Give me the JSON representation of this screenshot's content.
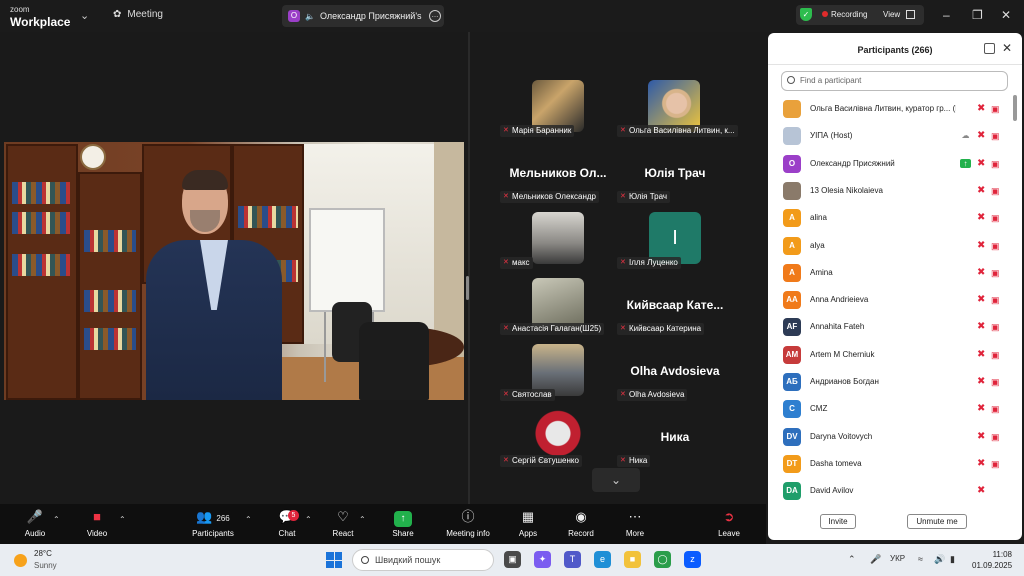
{
  "app": {
    "brand_top": "zoom",
    "brand_bottom": "Workplace",
    "meeting_label": "Meeting",
    "share_tab_avatar": "O",
    "share_tab_title": "Олександр Присяжний's screen",
    "recording_label": "Recording",
    "view_label": "View",
    "accent": "#0b5cff",
    "recording_color": "#e02b2b",
    "shield_color": "#2dbd4e"
  },
  "gallery": {
    "tiles": [
      {
        "name": "Марія Баранник",
        "big": ""
      },
      {
        "name": "Ольга Василівна Литвин, к...",
        "big": ""
      },
      {
        "name": "Мельников Олександр",
        "big": "Мельников Ол..."
      },
      {
        "name": "Юлія Трач",
        "big": "Юлія Трач"
      },
      {
        "name": "макс",
        "big": ""
      },
      {
        "name": "Ілля Луценко",
        "big": ""
      },
      {
        "name": "Анастасія Галаган(Ш25)",
        "big": ""
      },
      {
        "name": "Кийвсаар Катерина",
        "big": "Кийвсаар Кате..."
      },
      {
        "name": "Святослав",
        "big": ""
      },
      {
        "name": "Olha Avdosieva",
        "big": "Olha Avdosieva"
      },
      {
        "name": "Сергій Євтушенко",
        "big": ""
      },
      {
        "name": "Ника",
        "big": "Ника"
      }
    ],
    "illia_initial": "I"
  },
  "participants": {
    "title": "Participants (266)",
    "search_placeholder": "Find a participant",
    "list": [
      {
        "initials": "",
        "name": "Ольга Василівна Литвин, куратор гр... (Me)",
        "color": "#e9a13b",
        "extra": ""
      },
      {
        "initials": "",
        "name": "УІПА (Host)",
        "color": "#b7c4d6",
        "extra": "cloud"
      },
      {
        "initials": "О",
        "name": "Олександр Присяжний",
        "color": "#9b3fc8",
        "extra": "share"
      },
      {
        "initials": "",
        "name": "13 Olesia Nikolaieva",
        "color": "#8a7a6a",
        "extra": ""
      },
      {
        "initials": "A",
        "name": "alina",
        "color": "#f29b1a",
        "extra": ""
      },
      {
        "initials": "A",
        "name": "alya",
        "color": "#f29b1a",
        "extra": ""
      },
      {
        "initials": "A",
        "name": "Amina",
        "color": "#f07a1a",
        "extra": ""
      },
      {
        "initials": "AA",
        "name": "Anna Andrieieva",
        "color": "#f07a1a",
        "extra": ""
      },
      {
        "initials": "AF",
        "name": "Annahita Fateh",
        "color": "#2d3b55",
        "extra": ""
      },
      {
        "initials": "AM",
        "name": "Artem M Cherniuk",
        "color": "#c63b3b",
        "extra": ""
      },
      {
        "initials": "АБ",
        "name": "Андрианов Богдан",
        "color": "#2e6fbd",
        "extra": ""
      },
      {
        "initials": "C",
        "name": "CMZ",
        "color": "#2e7fd0",
        "extra": ""
      },
      {
        "initials": "DV",
        "name": "Daryna Voitovych",
        "color": "#2e6fbd",
        "extra": ""
      },
      {
        "initials": "DT",
        "name": "Dasha tomeva",
        "color": "#f29b1a",
        "extra": ""
      },
      {
        "initials": "DA",
        "name": "David Avilov",
        "color": "#1f9e6a",
        "extra": ""
      }
    ],
    "invite_label": "Invite",
    "unmute_label": "Unmute me"
  },
  "toolbar": {
    "audio": "Audio",
    "video": "Video",
    "participants": "Participants",
    "participants_count": "266",
    "chat": "Chat",
    "chat_badge": "5",
    "react": "React",
    "share": "Share",
    "meeting_info": "Meeting info",
    "apps": "Apps",
    "record": "Record",
    "more": "More",
    "leave": "Leave"
  },
  "taskbar": {
    "temp": "28°C",
    "weather": "Sunny",
    "search_placeholder": "Швидкий пошук",
    "lang": "УКР",
    "time": "11:08",
    "date": "01.09.2025"
  }
}
